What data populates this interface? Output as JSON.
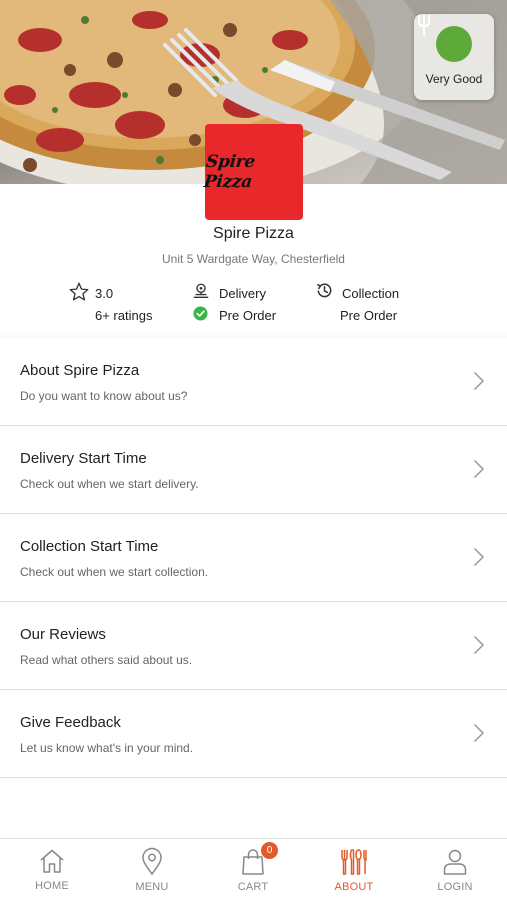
{
  "hygiene": {
    "label": "Very Good",
    "icon": "fork-rating-icon",
    "color": "#5daa3a"
  },
  "store": {
    "logo_text": "Spire Pizza",
    "name": "Spire Pizza",
    "address": "Unit 5 Wardgate Way, Chesterfield"
  },
  "stats": {
    "rating": "3.0",
    "ratings_count": "6+ ratings",
    "delivery_label": "Delivery",
    "delivery_status": "Pre Order",
    "collection_label": "Collection",
    "collection_status": "Pre Order"
  },
  "menu_items": [
    {
      "title": "About Spire Pizza",
      "subtitle": "Do you want to know about us?"
    },
    {
      "title": "Delivery Start Time",
      "subtitle": "Check out when we start delivery."
    },
    {
      "title": "Collection Start Time",
      "subtitle": "Check out when we start collection."
    },
    {
      "title": "Our Reviews",
      "subtitle": "Read what others said about us."
    },
    {
      "title": "Give Feedback",
      "subtitle": "Let us know what's in your mind."
    }
  ],
  "nav": {
    "home": "HOME",
    "menu": "MENU",
    "cart": "CART",
    "cart_count": "0",
    "about": "ABOUT",
    "login": "LOGIN",
    "active": "about",
    "accent": "#e05a2b"
  }
}
